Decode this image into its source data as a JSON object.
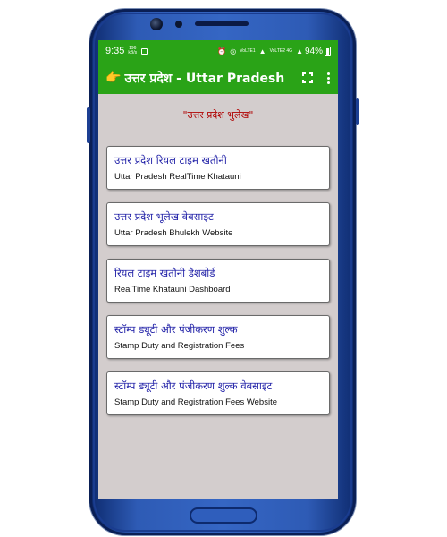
{
  "status_bar": {
    "time": "9:35",
    "speed_value": "196",
    "speed_unit": "kB/s",
    "network_1": "VoLTE1",
    "network_2": "VoLTE2 4G",
    "battery": "94%"
  },
  "app_bar": {
    "icon": "👉",
    "title": "उत्तर प्रदेश - Uttar Pradesh",
    "fullscreen_icon": "fullscreen-icon",
    "more_icon": "more-vert-icon"
  },
  "main": {
    "heading": "\"उत्तर प्रदेश भुलेख\"",
    "items": [
      {
        "hindi": "उत्तर प्रदेश रियल टाइम खतौनी",
        "english": "Uttar Pradesh RealTime Khatauni"
      },
      {
        "hindi": "उत्तर प्रदेश भूलेख वेबसाइट",
        "english": "Uttar Pradesh Bhulekh Website"
      },
      {
        "hindi": "रियल टाइम खतौनी डैशबोर्ड",
        "english": "RealTime Khatauni Dashboard"
      },
      {
        "hindi": "स्टॉम्प ड्यूटी और पंजीकरण शुल्क",
        "english": "Stamp Duty and Registration Fees"
      },
      {
        "hindi": "स्टॉम्प ड्यूटी और पंजीकरण शुल्क वेबसाइट",
        "english": "Stamp Duty and Registration Fees Website"
      }
    ]
  },
  "colors": {
    "app_bar": "#2aa317",
    "screen_bg": "#d3cdcd",
    "heading": "#b00000",
    "card_title": "#2222a8",
    "phone_body": "#3566c4"
  }
}
